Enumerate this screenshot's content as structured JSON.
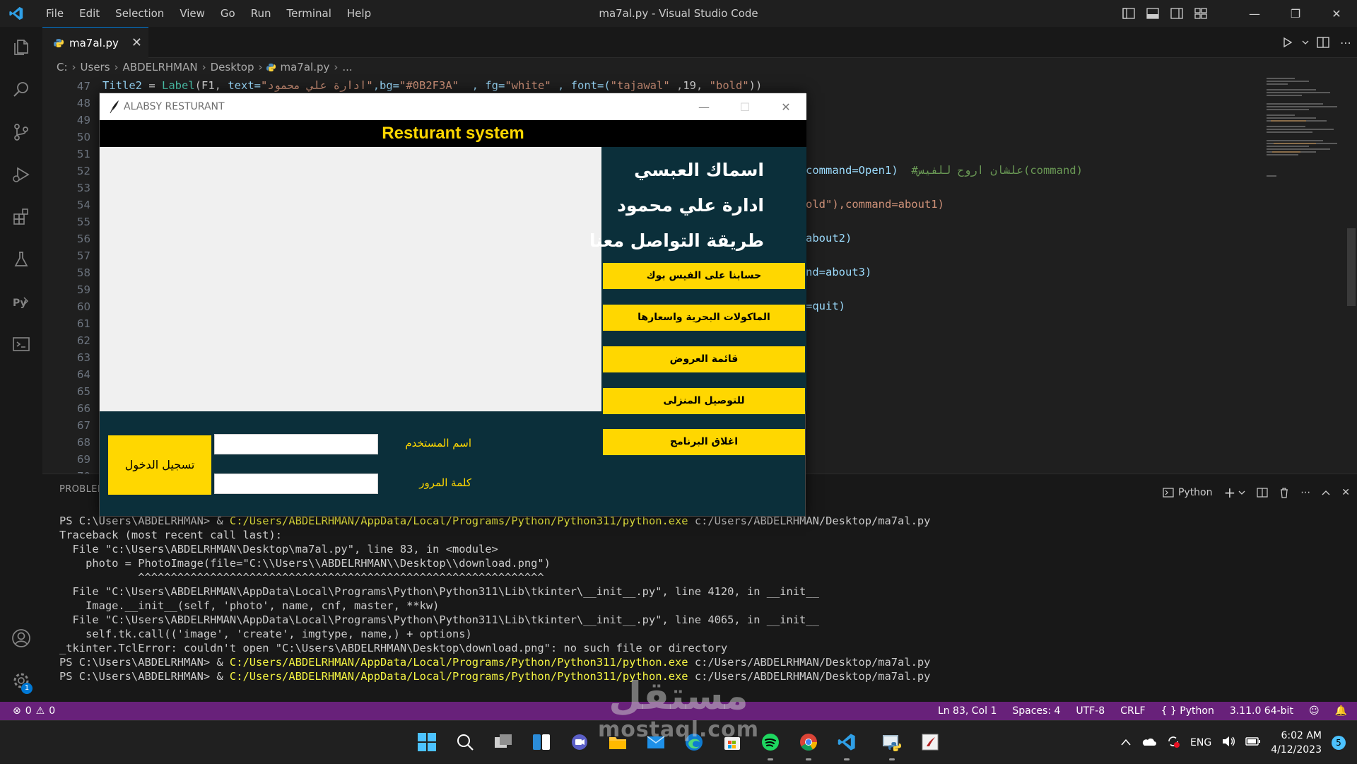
{
  "titlebar": {
    "menu": [
      "File",
      "Edit",
      "Selection",
      "View",
      "Go",
      "Run",
      "Terminal",
      "Help"
    ],
    "window_title": "ma7al.py - Visual Studio Code"
  },
  "tabs": [
    {
      "label": "ma7al.py",
      "active": true
    }
  ],
  "breadcrumb": [
    "C:",
    "Users",
    "ABDELRHMAN",
    "Desktop",
    "ma7al.py",
    "..."
  ],
  "editor": {
    "line_numbers": [
      "47",
      "48",
      "49",
      "50",
      "51",
      "52",
      "53",
      "54",
      "55",
      "56",
      "57",
      "58",
      "59",
      "60",
      "61",
      "62",
      "63",
      "64",
      "65",
      "66",
      "67",
      "68",
      "69",
      "70"
    ],
    "line47": {
      "var": "Title2",
      "eq": " = ",
      "fn": "Label",
      "args_a": "(F1, ",
      "kw1": "text=",
      "str1": "\"ادارة علي محمود\"",
      "kw2": ",bg=",
      "str2": "\"#0B2F3A\"",
      "kw3": "  , fg=",
      "str3": "\"white\"",
      "kw4": " , font=(",
      "str4": "\"tajawal\"",
      "num": " ,19, ",
      "str5": "\"bold\"",
      "close": "))"
    },
    "visible_fragments": {
      "l52_code": "command=Open1)",
      "l52_comment": "#علشان اروح للفيس(command)",
      "l54": "old\"),command=about1)",
      "l56": "about2)",
      "l58": "nd=about3)",
      "l60": "=quit)"
    }
  },
  "panel": {
    "tab_label": "PROBLEMS",
    "shell_label": "Python",
    "terminal_lines": [
      {
        "prompt": "PS C:\\Users\\ABDELRHMAN> & ",
        "path": "C:/Users/ABDELRHMAN/AppData/Local/Programs/Python/Python311/python.exe",
        "rest": " c:/Users/ABDELRHMAN/Desktop/ma7al.py"
      },
      {
        "prompt": "Traceback (most recent call last):",
        "path": "",
        "rest": ""
      },
      {
        "prompt": "  File \"c:\\Users\\ABDELRHMAN\\Desktop\\ma7al.py\", line 83, in <module>",
        "path": "",
        "rest": ""
      },
      {
        "prompt": "    photo = PhotoImage(file=\"C:\\\\Users\\\\ABDELRHMAN\\\\Desktop\\\\download.png\")",
        "path": "",
        "rest": ""
      },
      {
        "prompt": "            ^^^^^^^^^^^^^^^^^^^^^^^^^^^^^^^^^^^^^^^^^^^^^^^^^^^^^^^^^^^^^^",
        "path": "",
        "rest": ""
      },
      {
        "prompt": "  File \"C:\\Users\\ABDELRHMAN\\AppData\\Local\\Programs\\Python\\Python311\\Lib\\tkinter\\__init__.py\", line 4120, in __init__",
        "path": "",
        "rest": ""
      },
      {
        "prompt": "    Image.__init__(self, 'photo', name, cnf, master, **kw)",
        "path": "",
        "rest": ""
      },
      {
        "prompt": "  File \"C:\\Users\\ABDELRHMAN\\AppData\\Local\\Programs\\Python\\Python311\\Lib\\tkinter\\__init__.py\", line 4065, in __init__",
        "path": "",
        "rest": ""
      },
      {
        "prompt": "    self.tk.call(('image', 'create', imgtype, name,) + options)",
        "path": "",
        "rest": ""
      },
      {
        "prompt": "_tkinter.TclError: couldn't open \"C:\\Users\\ABDELRHMAN\\Desktop\\download.png\": no such file or directory",
        "path": "",
        "rest": ""
      },
      {
        "prompt": "PS C:\\Users\\ABDELRHMAN> & ",
        "path": "C:/Users/ABDELRHMAN/AppData/Local/Programs/Python/Python311/python.exe",
        "rest": " c:/Users/ABDELRHMAN/Desktop/ma7al.py"
      },
      {
        "prompt": "PS C:\\Users\\ABDELRHMAN> & ",
        "path": "C:/Users/ABDELRHMAN/AppData/Local/Programs/Python/Python311/python.exe",
        "rest": " c:/Users/ABDELRHMAN/Desktop/ma7al.py"
      }
    ]
  },
  "statusbar": {
    "errors": "0",
    "warnings": "0",
    "position": "Ln 83, Col 1",
    "spaces": "Spaces: 4",
    "encoding": "UTF-8",
    "eol": "CRLF",
    "language": "Python",
    "interpreter": "3.11.0 64-bit"
  },
  "activity_badge": "1",
  "tkwindow": {
    "title": "ALABSY RESTURANT",
    "header": "Resturant system",
    "side_titles": [
      "اسماك العبسي",
      "ادارة علي محمود",
      "طريقة التواصل معنا"
    ],
    "buttons": [
      "حسابنا على الفيس بوك",
      "الماكولات البحرية واسعارها",
      "قائمة العروض",
      "للتوصيل المنزلى",
      "اغلاق البرنامج"
    ],
    "login_button": "تسجيل الدخول",
    "username_label": "اسم المستخدم",
    "password_label": "كلمة المرور",
    "username_value": "",
    "password_value": ""
  },
  "watermark": {
    "arabic": "مستقل",
    "latin": "mostaql.com"
  },
  "taskbar": {
    "language": "ENG",
    "time": "6:02 AM",
    "date": "4/12/2023",
    "notifications": "5"
  },
  "colors": {
    "accent": "#0078d4",
    "statusbar": "#68217a",
    "tk_bg": "#0B2F3A",
    "tk_yellow": "#FFD700"
  }
}
